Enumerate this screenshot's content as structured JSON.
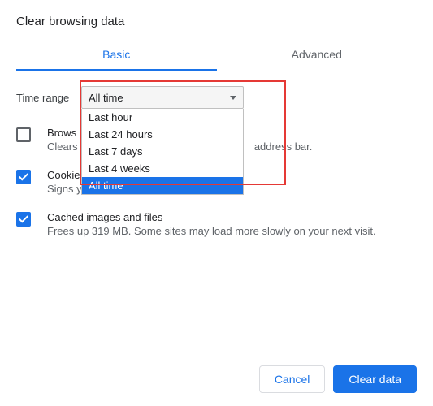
{
  "dialog": {
    "title": "Clear browsing data",
    "tabs": {
      "basic": "Basic",
      "advanced": "Advanced"
    },
    "time_range": {
      "label": "Time range",
      "selected": "All time",
      "options": [
        "Last hour",
        "Last 24 hours",
        "Last 7 days",
        "Last 4 weeks",
        "All time"
      ]
    },
    "items": [
      {
        "title": "Browsing history",
        "truncated_title": "Brows",
        "desc": "Clears history and autocompletions in the address bar.",
        "truncated_desc_left": "Clears",
        "truncated_desc_right": "address bar.",
        "checked": false
      },
      {
        "title": "Cookies and other site data",
        "desc": "Signs you out of most sites.",
        "checked": true
      },
      {
        "title": "Cached images and files",
        "desc": "Frees up 319 MB. Some sites may load more slowly on your next visit.",
        "checked": true
      }
    ],
    "footer": {
      "cancel": "Cancel",
      "confirm": "Clear data"
    }
  }
}
